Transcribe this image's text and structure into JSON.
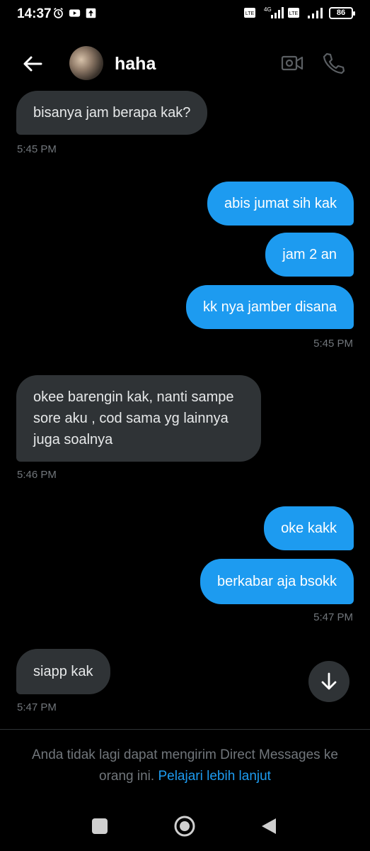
{
  "status_bar": {
    "time": "14:37",
    "battery": "86"
  },
  "header": {
    "contact_name": "haha"
  },
  "messages": [
    {
      "direction": "in",
      "text": "bisanya jam berapa kak?"
    },
    {
      "direction": "time",
      "text": "5:45 PM"
    },
    {
      "direction": "out",
      "text": "abis jumat sih kak"
    },
    {
      "direction": "out",
      "text": "jam 2 an"
    },
    {
      "direction": "out",
      "text": "kk nya jamber disana"
    },
    {
      "direction": "time",
      "text": "5:45 PM"
    },
    {
      "direction": "in",
      "text": "okee barengin kak, nanti sampe sore aku , cod sama yg lainnya juga soalnya"
    },
    {
      "direction": "time",
      "text": "5:46 PM"
    },
    {
      "direction": "out",
      "text": "oke kakk"
    },
    {
      "direction": "out",
      "text": "berkabar aja bsokk"
    },
    {
      "direction": "time",
      "text": "5:47 PM"
    },
    {
      "direction": "in",
      "text": "siapp kak"
    },
    {
      "direction": "time",
      "text": "5:47 PM"
    }
  ],
  "notice": {
    "text": "Anda tidak lagi dapat mengirim Direct Messages ke orang ini. ",
    "link": "Pelajari lebih lanjut"
  },
  "icons": {
    "back": "arrow-left-icon",
    "video": "video-camera-icon",
    "call": "phone-icon",
    "scroll": "arrow-down-icon"
  },
  "colors": {
    "accent": "#1d9bf0",
    "incoming_bubble": "#2f3336",
    "background": "#000000",
    "muted_text": "#71767b"
  }
}
